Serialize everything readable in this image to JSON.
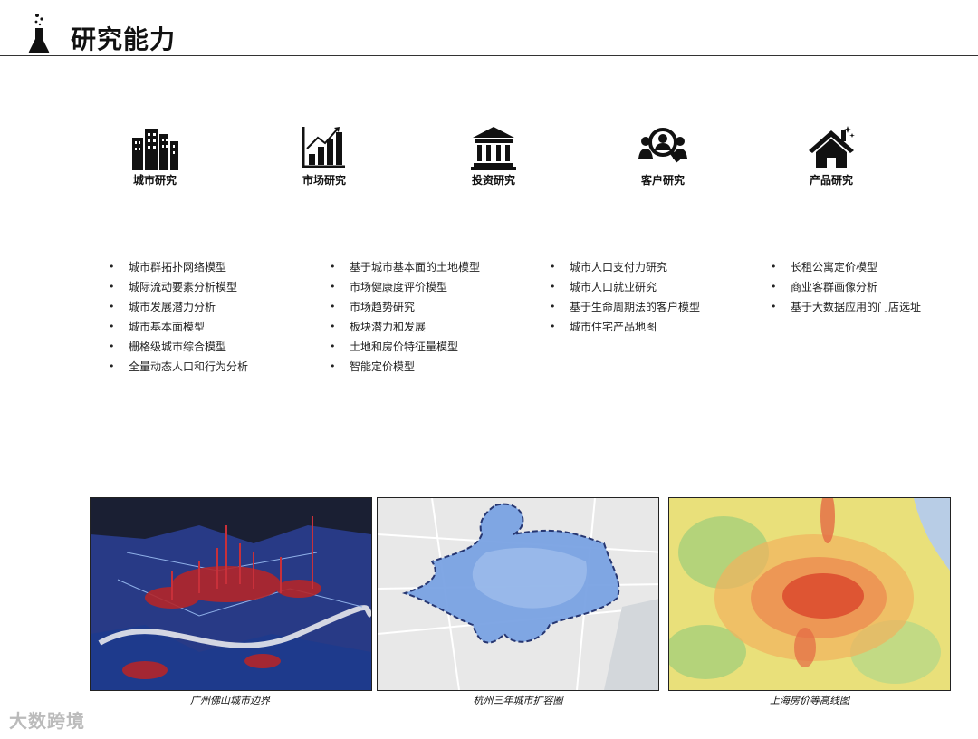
{
  "header": {
    "title": "研究能力",
    "icon": "flask-icon"
  },
  "categories": [
    {
      "label": "城市研究",
      "icon": "buildings-icon"
    },
    {
      "label": "市场研究",
      "icon": "bar-chart-icon"
    },
    {
      "label": "投资研究",
      "icon": "bank-icon"
    },
    {
      "label": "客户研究",
      "icon": "people-search-icon"
    },
    {
      "label": "产品研究",
      "icon": "house-icon"
    }
  ],
  "lists": [
    [
      "城市群拓扑网络模型",
      "城际流动要素分析模型",
      "城市发展潜力分析",
      "城市基本面模型",
      "栅格级城市综合模型",
      "全量动态人口和行为分析"
    ],
    [
      "基于城市基本面的土地模型",
      "市场健康度评价模型",
      "市场趋势研究",
      "板块潜力和发展",
      "土地和房价特征量模型",
      "智能定价模型"
    ],
    [
      "城市人口支付力研究",
      "城市人口就业研究",
      "基于生命周期法的客户模型",
      "城市住宅产品地图"
    ],
    [
      "长租公寓定价模型",
      "商业客群画像分析",
      "基于大数据应用的门店选址"
    ]
  ],
  "maps": [
    {
      "caption": "广州佛山城市边界"
    },
    {
      "caption": "杭州三年城市扩容圈"
    },
    {
      "caption": "上海房价等高线图"
    }
  ],
  "watermark": "大数跨境",
  "colors": {
    "accent": "#111111",
    "map_dark": "#1a2a6a",
    "map_blue": "#6f9fe0",
    "heat_red": "#d9452b"
  }
}
